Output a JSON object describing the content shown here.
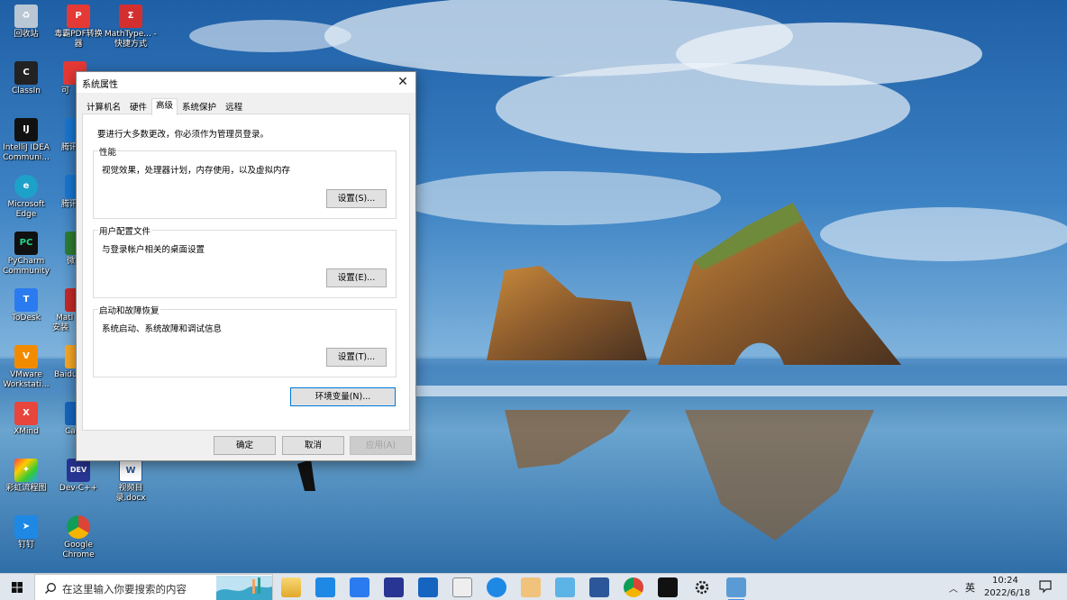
{
  "desktop": {
    "icons": [
      {
        "label": "回收站"
      },
      {
        "label": "毒霸PDF转换器"
      },
      {
        "label": "MathType... - 快捷方式"
      },
      {
        "label": "ClassIn"
      },
      {
        "label": "IntelliJ IDEA Communi..."
      },
      {
        "label": "Microsoft Edge"
      },
      {
        "label": "PyCharm Community"
      },
      {
        "label": "ToDesk"
      },
      {
        "label": "VMware Workstati..."
      },
      {
        "label": "XMind"
      },
      {
        "label": "彩虹流程图"
      },
      {
        "label": "Dev-C++"
      },
      {
        "label": "视频目录.docx"
      },
      {
        "label": "钉钉"
      },
      {
        "label": "Google Chrome"
      }
    ],
    "partial_labels": [
      "可",
      "腾讯",
      "腾讯",
      "微",
      "Matl 安装",
      "Baidu",
      "Ca"
    ]
  },
  "dialog": {
    "title": "系统属性",
    "close_glyph": "✕",
    "tabs": [
      {
        "label": "计算机名"
      },
      {
        "label": "硬件"
      },
      {
        "label": "高级",
        "active": true
      },
      {
        "label": "系统保护"
      },
      {
        "label": "远程"
      }
    ],
    "admin_note": "要进行大多数更改，你必须作为管理员登录。",
    "groups": {
      "performance": {
        "title": "性能",
        "desc": "视觉效果，处理器计划，内存使用，以及虚拟内存",
        "button": "设置(S)..."
      },
      "user_profiles": {
        "title": "用户配置文件",
        "desc": "与登录帐户相关的桌面设置",
        "button": "设置(E)..."
      },
      "startup_recovery": {
        "title": "启动和故障恢复",
        "desc": "系统启动、系统故障和调试信息",
        "button": "设置(T)..."
      }
    },
    "env_button": "环境变量(N)...",
    "ok": "确定",
    "cancel": "取消",
    "apply": "应用(A)"
  },
  "taskbar": {
    "search_placeholder": "在这里输入你要搜索的内容",
    "tray_chevron": "︿",
    "ime": "英",
    "time": "10:24",
    "date": "2022/6/18",
    "colors": {
      "accent": "#0078d7"
    }
  }
}
